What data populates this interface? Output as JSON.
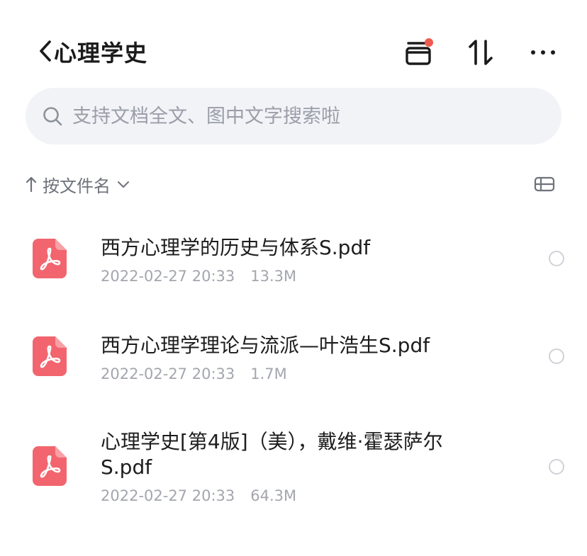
{
  "header": {
    "title": "心理学史"
  },
  "search": {
    "placeholder": "支持文档全文、图中文字搜索啦"
  },
  "sort": {
    "label": "按文件名"
  },
  "files": [
    {
      "name": "西方心理学的历史与体系S.pdf",
      "date": "2022-02-27 20:33",
      "size": "13.3M"
    },
    {
      "name": "西方心理学理论与流派—叶浩生S.pdf",
      "date": "2022-02-27 20:33",
      "size": "1.7M"
    },
    {
      "name": "心理学史[第4版]（美），戴维·霍瑟萨尔S.pdf",
      "date": "2022-02-27 20:33",
      "size": "64.3M"
    }
  ],
  "colors": {
    "accent_dot": "#ef5a4f",
    "pdf_icon": "#f2656e",
    "search_bg": "#f1f3f7"
  },
  "icons": {
    "back": "chevron-left-icon",
    "transfer": "archive-box-icon",
    "sort_toggle": "sort-arrows-icon",
    "more": "more-dots-icon",
    "search": "search-icon",
    "view": "list-view-icon",
    "file": "pdf-icon"
  }
}
